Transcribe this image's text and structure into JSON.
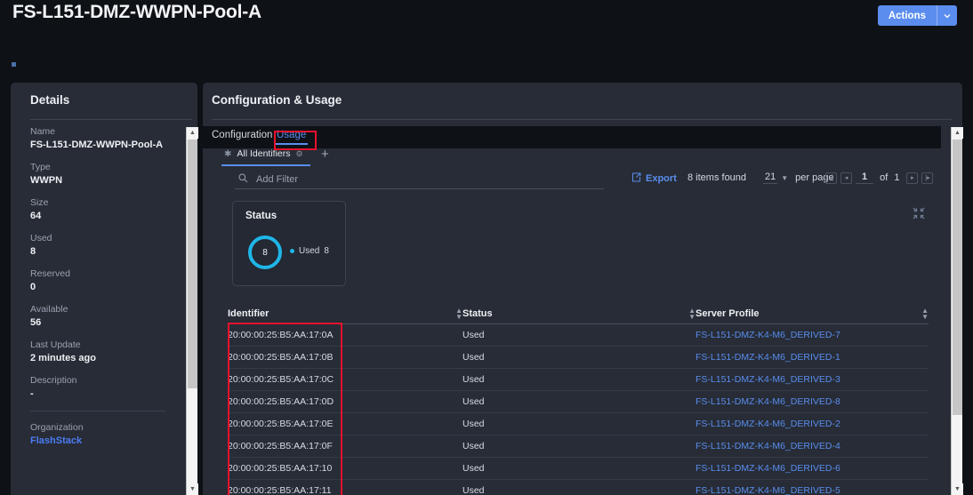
{
  "header": {
    "title": "FS-L151-DMZ-WWPN-Pool-A",
    "actions_label": "Actions",
    "actions_caret": "⌄"
  },
  "details": {
    "title": "Details",
    "fields": [
      {
        "label": "Name",
        "value": "FS-L151-DMZ-WWPN-Pool-A"
      },
      {
        "label": "Type",
        "value": "WWPN"
      },
      {
        "label": "Size",
        "value": "64"
      },
      {
        "label": "Used",
        "value": "8"
      },
      {
        "label": "Reserved",
        "value": "0"
      },
      {
        "label": "Available",
        "value": "56"
      },
      {
        "label": "Last Update",
        "value": "2 minutes ago"
      },
      {
        "label": "Description",
        "value": "-"
      },
      {
        "label": "Organization",
        "value": "FlashStack",
        "link": true
      }
    ]
  },
  "main": {
    "title": "Configuration & Usage",
    "tabs": [
      {
        "label": "Configuration",
        "active": false
      },
      {
        "label": "Usage",
        "active": true
      }
    ],
    "saved_view": {
      "label": "All Identifiers",
      "star_icon": "✳",
      "gear_icon": "⚙",
      "add_label": "+"
    },
    "filter": {
      "placeholder": "Add Filter",
      "search_icon": "search-icon"
    },
    "toolbar": {
      "export_label": "Export",
      "export_icon": "export-icon",
      "items_found": "8 items found",
      "per_page_value": "21",
      "per_page_label": "per page",
      "page_current": "1",
      "page_of": "of",
      "page_total": "1",
      "first_icon": "⧏",
      "prev_icon": "‹",
      "next_icon": "›",
      "last_icon": "⧐"
    },
    "status_card": {
      "title": "Status",
      "center_value": "8",
      "legend_label": "Used",
      "legend_value": "8",
      "accent_color": "#1fb6e8"
    },
    "table": {
      "columns": [
        "Identifier",
        "Status",
        "Server Profile"
      ],
      "rows": [
        {
          "identifier": "20:00:00:25:B5:AA:17:0A",
          "status": "Used",
          "profile": "FS-L151-DMZ-K4-M6_DERIVED-7"
        },
        {
          "identifier": "20:00:00:25:B5:AA:17:0B",
          "status": "Used",
          "profile": "FS-L151-DMZ-K4-M6_DERIVED-1"
        },
        {
          "identifier": "20:00:00:25:B5:AA:17:0C",
          "status": "Used",
          "profile": "FS-L151-DMZ-K4-M6_DERIVED-3"
        },
        {
          "identifier": "20:00:00:25:B5:AA:17:0D",
          "status": "Used",
          "profile": "FS-L151-DMZ-K4-M6_DERIVED-8"
        },
        {
          "identifier": "20:00:00:25:B5:AA:17:0E",
          "status": "Used",
          "profile": "FS-L151-DMZ-K4-M6_DERIVED-2"
        },
        {
          "identifier": "20:00:00:25:B5:AA:17:0F",
          "status": "Used",
          "profile": "FS-L151-DMZ-K4-M6_DERIVED-4"
        },
        {
          "identifier": "20:00:00:25:B5:AA:17:10",
          "status": "Used",
          "profile": "FS-L151-DMZ-K4-M6_DERIVED-6"
        },
        {
          "identifier": "20:00:00:25:B5:AA:17:11",
          "status": "Used",
          "profile": "FS-L151-DMZ-K4-M6_DERIVED-5"
        }
      ]
    }
  },
  "annotations": {
    "usage_tab_highlight_color": "#e8112d",
    "identifier_column_highlight_color": "#e8112d"
  }
}
